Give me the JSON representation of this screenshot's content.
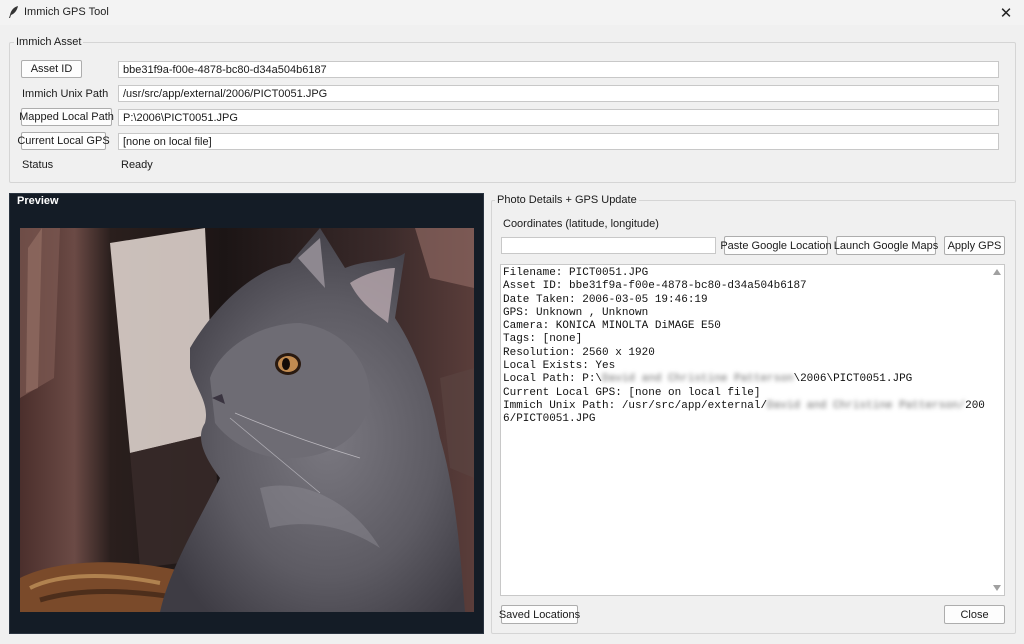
{
  "window": {
    "title": "Immich GPS Tool",
    "close_glyph": "✕",
    "app_icon": "feather-icon"
  },
  "asset_group": {
    "label": "Immich Asset",
    "asset_id_button": "Asset ID",
    "asset_id_value": "bbe31f9a-f00e-4878-bc80-d34a504b6187",
    "unix_path_label": "Immich Unix Path",
    "unix_path_value": "/usr/src/app/external/2006/PICT0051.JPG",
    "mapped_path_button": "Mapped Local Path",
    "mapped_path_value": "P:\\2006\\PICT0051.JPG",
    "local_gps_button": "Current Local GPS",
    "local_gps_value": "[none on local file]",
    "status_label": "Status",
    "status_value": "Ready"
  },
  "preview": {
    "label": "Preview"
  },
  "details_group": {
    "label": "Photo Details + GPS Update",
    "coords_label": "Coordinates (latitude, longitude)",
    "coords_value": "",
    "paste_button": "Paste Google Location",
    "launch_button": "Launch Google Maps",
    "apply_button": "Apply GPS",
    "details": {
      "filename": "Filename: PICT0051.JPG",
      "asset_id": "Asset ID: bbe31f9a-f00e-4878-bc80-d34a504b6187",
      "date_taken": "Date Taken: 2006-03-05 19:46:19",
      "gps": "GPS: Unknown , Unknown",
      "camera": "Camera: KONICA MINOLTA DiMAGE E50",
      "tags": "Tags: [none]",
      "resolution": "Resolution: 2560 x 1920",
      "local_exists": "Local Exists: Yes",
      "local_path_prefix": "Local Path: P:\\",
      "local_path_redacted": "David and Christine Patterson",
      "local_path_suffix": "\\2006\\PICT0051.JPG",
      "current_local_gps": "Current Local GPS: [none on local file]",
      "unix_path_prefix": "Immich Unix Path: /usr/src/app/external/",
      "unix_path_redacted": "David and Christine Patterson/",
      "unix_path_suffix": "2006/PICT0051.JPG"
    },
    "saved_locations_button": "Saved Locations",
    "close_button": "Close"
  },
  "colors": {
    "window_bg": "#f0f0f0",
    "preview_bg": "#141c26",
    "field_bg": "#ffffff"
  }
}
